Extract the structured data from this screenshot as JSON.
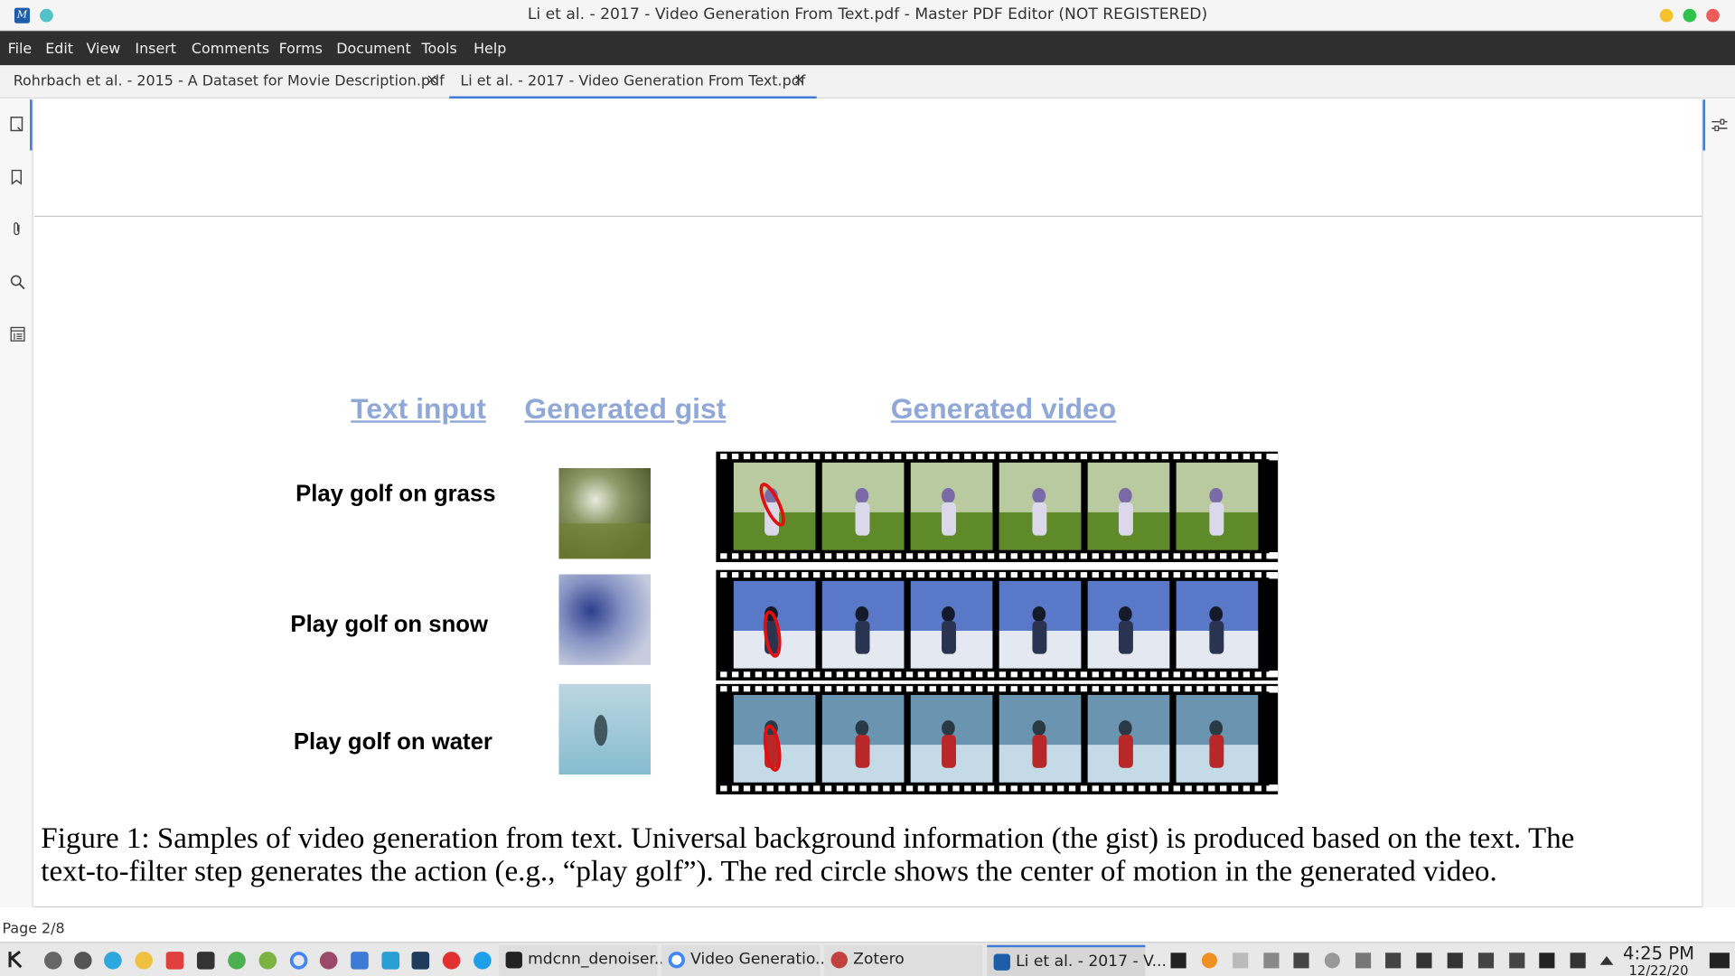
{
  "window": {
    "title": "Li et al. - 2017 - Video Generation From Text.pdf - Master PDF Editor (NOT REGISTERED)"
  },
  "menu": [
    "File",
    "Edit",
    "View",
    "Insert",
    "Comments",
    "Forms",
    "Document",
    "Tools",
    "Help"
  ],
  "tabs": [
    {
      "label": "Rohrbach et al. - 2015 - A Dataset for Movie Description.pdf",
      "close": "×",
      "active": false
    },
    {
      "label": "Li et al. - 2017 - Video Generation From Text.pdf",
      "close": "×",
      "active": true
    }
  ],
  "figure": {
    "headers": {
      "text_input": "Text input",
      "generated_gist": "Generated gist",
      "generated_video": "Generated video"
    },
    "rows": [
      {
        "label": "Play golf on grass",
        "scene": "grass"
      },
      {
        "label": "Play golf on snow",
        "scene": "snow"
      },
      {
        "label": "Play golf on water",
        "scene": "water"
      }
    ],
    "caption_line1": "Figure 1: Samples of video generation from text. Universal background information (the gist) is produced based on the text. The",
    "caption_line2": "text-to-filter step generates the action (e.g., “play golf”). The red circle shows the center of motion in the generated video."
  },
  "status": {
    "page": "Page 2/8"
  },
  "taskbar": {
    "tasks": [
      {
        "label": "mdcnn_denoiser...",
        "icon": "terminal-icon",
        "active": false
      },
      {
        "label": "Video Generatio...",
        "icon": "chrome-icon",
        "active": false
      },
      {
        "label": "Zotero",
        "icon": "zotero-icon",
        "active": false
      },
      {
        "label": "Li et al. - 2017 - V...",
        "icon": "master-pdf-icon",
        "active": true
      }
    ],
    "clock_time": "4:25 PM",
    "clock_date": "12/22/20"
  },
  "colors": {
    "accent": "#3d7bd6",
    "menubar": "#2f2f2f",
    "header_text": "#8fa8d8",
    "highlight_circle": "#e01010"
  }
}
